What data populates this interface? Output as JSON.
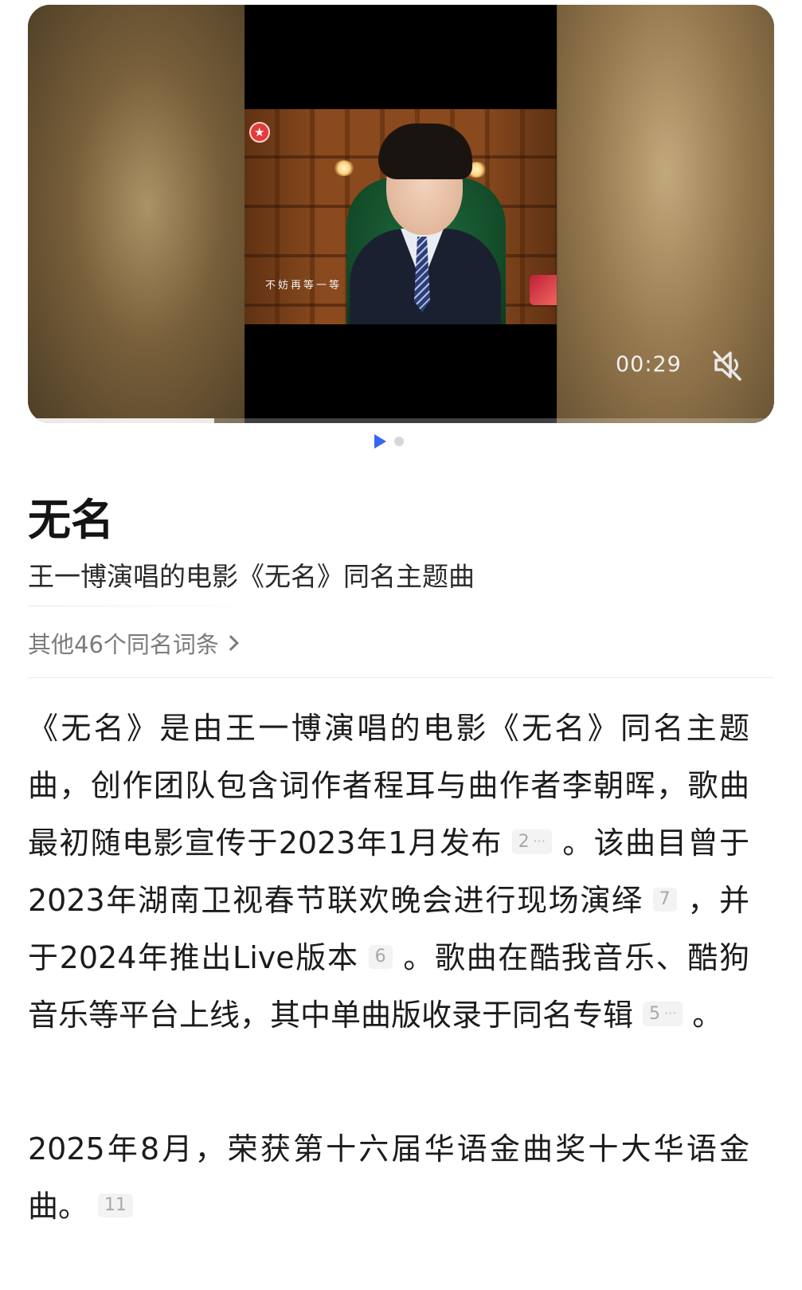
{
  "video": {
    "subtitle": "不妨再等一等",
    "time": "00:29",
    "progress": 0.25
  },
  "carousel": {
    "pages": 2,
    "active": 1
  },
  "entry": {
    "title": "无名",
    "description": "王一博演唱的电影《无名》同名主题曲",
    "other_link": "其他46个同名词条"
  },
  "body": {
    "p1_seg1": "《无名》是由王一博演唱的电影《无名》同名主题曲，创作团队包含词作者程耳与曲作者李朝晖，歌曲最初随电影宣传于2023年1月发布",
    "ref_2": "2",
    "p1_seg2": "。该曲目曾于2023年湖南卫视春节联欢晚会进行现场演绎",
    "ref_7": "7",
    "p1_seg3": "，并于2024年推出Live版本",
    "ref_6": "6",
    "p1_seg4": "。歌曲在酷我音乐、酷狗音乐等平台上线，其中单曲版收录于同名专辑",
    "ref_5": "5",
    "p1_seg5": "。",
    "p2_seg1": "2025年8月，荣获第十六届华语金曲奖十大华语金曲。",
    "ref_11": "11",
    "ref_more": "···"
  },
  "colors": {
    "accent": "#3766f0",
    "text": "#1c1c1c",
    "muted": "#7b7b7b"
  },
  "icons": {
    "mute": "mute-icon",
    "play": "play-indicator-icon",
    "chevron": "chevron-right-icon"
  }
}
